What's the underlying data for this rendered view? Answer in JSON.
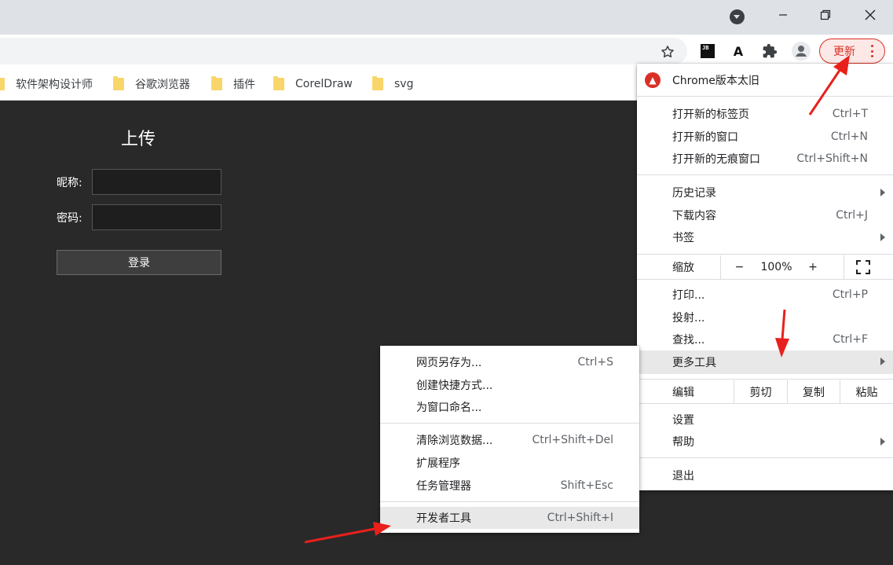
{
  "colors": {
    "accent_red": "#d93025",
    "page_bg": "#292929",
    "annotation_arrow": "#e8201c"
  },
  "window": {
    "profile_icon": "chevron-circle-icon",
    "minimize_icon": "minimize-icon",
    "maximize_icon": "restore-icon",
    "close_icon": "close-icon"
  },
  "toolbar": {
    "update_label": "更新",
    "jb_label": "JB",
    "a_label": "A",
    "icons": [
      "star-icon",
      "jetbrains-icon",
      "translate-a-icon",
      "puzzle-extension-icon",
      "profile-avatar-icon",
      "more-vert-icon"
    ]
  },
  "bookmarks": [
    {
      "label": "软件架构设计师"
    },
    {
      "label": "谷歌浏览器"
    },
    {
      "label": "插件"
    },
    {
      "label": "CorelDraw"
    },
    {
      "label": "svg"
    }
  ],
  "page": {
    "title": "上传",
    "nickname_label": "昵称:",
    "password_label": "密码:",
    "login_button": "登录"
  },
  "main_menu": {
    "update_item": "Chrome版本太旧",
    "new_tab": {
      "label": "打开新的标签页",
      "shortcut": "Ctrl+T"
    },
    "new_window": {
      "label": "打开新的窗口",
      "shortcut": "Ctrl+N"
    },
    "incognito": {
      "label": "打开新的无痕窗口",
      "shortcut": "Ctrl+Shift+N"
    },
    "history": {
      "label": "历史记录"
    },
    "downloads": {
      "label": "下载内容",
      "shortcut": "Ctrl+J"
    },
    "bookmarks": {
      "label": "书签"
    },
    "zoom": {
      "label": "缩放",
      "minus": "−",
      "value": "100%",
      "plus": "+"
    },
    "print": {
      "label": "打印...",
      "shortcut": "Ctrl+P"
    },
    "cast": {
      "label": "投射..."
    },
    "find": {
      "label": "查找...",
      "shortcut": "Ctrl+F"
    },
    "more_tools": {
      "label": "更多工具"
    },
    "edit": {
      "label": "编辑",
      "cut": "剪切",
      "copy": "复制",
      "paste": "粘贴"
    },
    "settings": {
      "label": "设置"
    },
    "help": {
      "label": "帮助"
    },
    "exit": {
      "label": "退出"
    }
  },
  "more_tools_menu": {
    "save_page": {
      "label": "网页另存为...",
      "shortcut": "Ctrl+S"
    },
    "create_shortcut": {
      "label": "创建快捷方式..."
    },
    "name_window": {
      "label": "为窗口命名..."
    },
    "clear_data": {
      "label": "清除浏览数据...",
      "shortcut": "Ctrl+Shift+Del"
    },
    "extensions": {
      "label": "扩展程序"
    },
    "task_manager": {
      "label": "任务管理器",
      "shortcut": "Shift+Esc"
    },
    "dev_tools": {
      "label": "开发者工具",
      "shortcut": "Ctrl+Shift+I"
    }
  }
}
